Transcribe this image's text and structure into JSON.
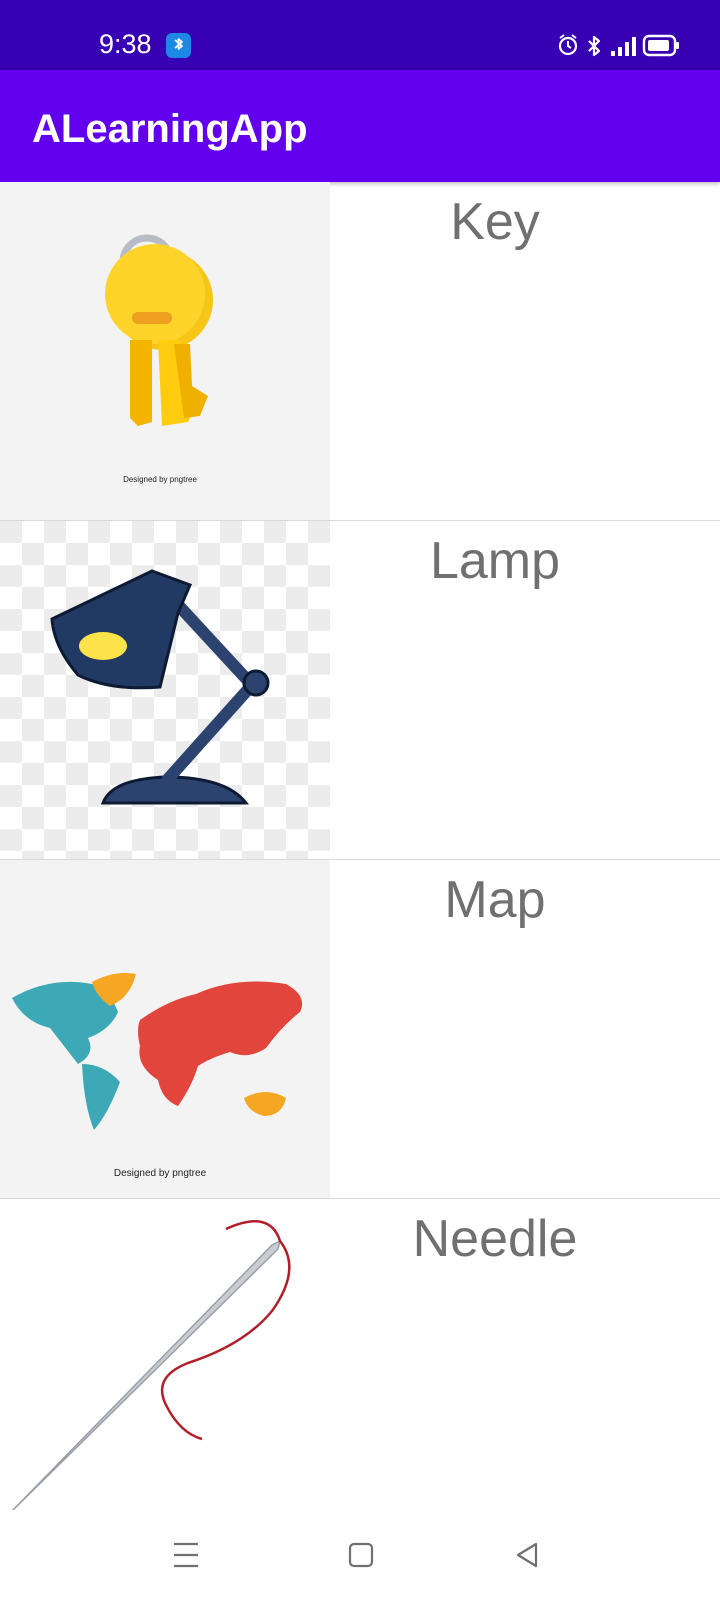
{
  "status_bar": {
    "time": "9:38",
    "icons": [
      "bluetooth-app-icon",
      "alarm-icon",
      "bluetooth-icon",
      "signal-icon",
      "battery-icon"
    ]
  },
  "app_bar": {
    "title": "ALearningApp"
  },
  "list": {
    "items": [
      {
        "label": "Key",
        "image": "key-image"
      },
      {
        "label": "Lamp",
        "image": "lamp-image"
      },
      {
        "label": "Map",
        "image": "map-image"
      },
      {
        "label": "Needle",
        "image": "needle-image"
      }
    ]
  },
  "watermarks": {
    "key": "Designed by pngtree",
    "map": "Designed by pngtree"
  },
  "nav_bar": {
    "buttons": [
      "menu-icon",
      "home-icon",
      "back-icon"
    ]
  },
  "colors": {
    "status_bar": "#3700b3",
    "app_bar": "#6200ee",
    "label_text": "#707070",
    "divider": "#d9d9d9"
  }
}
